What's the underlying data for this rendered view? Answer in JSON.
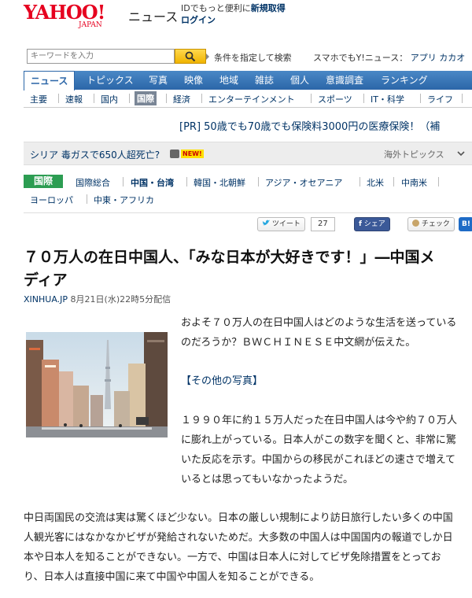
{
  "header": {
    "logo_text": "YAHOO!",
    "logo_sub": "JAPAN",
    "service": "ニュース",
    "promo": "IDでもっと便利に",
    "signup": "新規取得",
    "login": "ログイン"
  },
  "search": {
    "placeholder": "キーワードを入力",
    "conditions": "条件を指定して検索",
    "mobile_prefix": "スマホでもY!ニュース：",
    "mobile_links": "アプリ カカオ"
  },
  "nav": {
    "items": [
      "ニュース",
      "トピックス",
      "写真",
      "映像",
      "地域",
      "雑誌",
      "個人",
      "意識調査",
      "ランキング"
    ]
  },
  "subnav": {
    "items": [
      "主要",
      "速報",
      "国内",
      "国際",
      "経済",
      "エンターテインメント",
      "スポーツ",
      "IT・科学",
      "ライフ"
    ]
  },
  "pr": "[PR] 50歳でも70歳でも保険料3000円の医療保険！（補",
  "topic": {
    "text": "シリア 毒ガスで650人超死亡?",
    "badge": "NEW!",
    "overseas": "海外トピックス"
  },
  "category": {
    "label": "国際",
    "links": [
      "国際総合",
      "中国・台湾",
      "韓国・北朝鮮",
      "アジア・オセアニア",
      "北米",
      "中南米",
      "ヨーロッパ",
      "中東・アフリカ"
    ]
  },
  "social": {
    "tweet": "ツイート",
    "tweet_count": "27",
    "share": "シェア",
    "check": "チェック",
    "hatena": "B!"
  },
  "article": {
    "title_line1": "７０万人の在日中国人、「みな日本が大好きです！」―中国メ",
    "title_line2": "ディア",
    "source": "XINHUA.JP",
    "date": "8月21日(水)22時5分配信",
    "p1_line1": "およそ７０万人の在日中国人はどのような生活を送っている",
    "p1_line2": "のだろうか？ＢＷＣＨＩＮＥＳＥ中文網が伝えた。",
    "more_photos": "【その他の写真】",
    "p2_line1": "１９９０年に約１５万人だった在日中国人は今や約７０万人",
    "p2_line2": "に膨れ上がっている。日本人がこの数字を聞くと、非常に驚",
    "p2_line3": "いた反応を示す。中国からの移民がこれほどの速さで増えて",
    "p2_line4": "いるとは思ってもいなかったようだ。",
    "p3_line1": "中日両国民の交流は実は驚くほど少ない。日本の厳しい規制により訪日旅行したい多くの中国",
    "p3_line2": "人観光客にはなかなかビザが発給されないためだ。大多数の中国人は中国国内の報道でしか日",
    "p3_line3": "本や日本人を知ることができない。一方で、中国は日本人に対してビザ免除措置をとってお",
    "p3_line4": "り、日本人は直接中国に来て中国や中国人を知ることができる。"
  },
  "colors": {
    "brand_red": "#e6001f",
    "nav_blue": "#2b66a8",
    "category_green": "#2c9d52",
    "link_blue": "#003366"
  }
}
